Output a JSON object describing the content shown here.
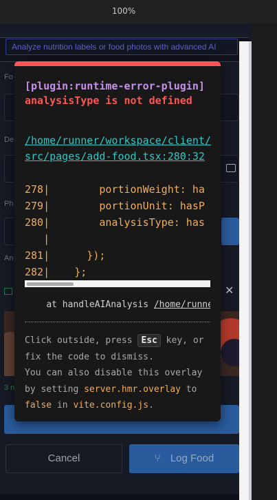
{
  "browser": {
    "zoom": "100%"
  },
  "app": {
    "subtitle": "Analyze nutrition labels or food photos with advanced AI",
    "labels": {
      "food": "Fo",
      "description": "De",
      "photo": "Ph",
      "analyze": "An",
      "count": "3 n"
    },
    "buttons": {
      "cancel": "Cancel",
      "log_food": "Log Food"
    }
  },
  "overlay": {
    "plugin": "[plugin:runtime-error-plugin]",
    "message": "analysisType is not defined",
    "file": "/home/runner/workspace/client/src/pages/add-food.tsx:280:32",
    "code_lines": [
      "278|        portionWeight: ha",
      "279|        portionUnit: hasP",
      "280|        analysisType: has",
      "   |",
      "281|      });",
      "282|    };"
    ],
    "stack_prefix": "at handleAIAnalysis ",
    "stack_path": "/home/runner",
    "tip": {
      "part1": "Click outside, press ",
      "key": "Esc",
      "part2": " key, or fix the code to dismiss.",
      "part3": "You can also disable this overlay by setting ",
      "setting": "server.hmr.overlay",
      "part4": " to ",
      "value": "false",
      "part5": " in ",
      "config": "vite.config.js",
      "part6": "."
    }
  },
  "colors": {
    "error": "#ff5555",
    "plugin": "#c792ea",
    "link": "#2dc7c4",
    "code": "#f0ad5b",
    "accent": "#2a5b9c"
  }
}
